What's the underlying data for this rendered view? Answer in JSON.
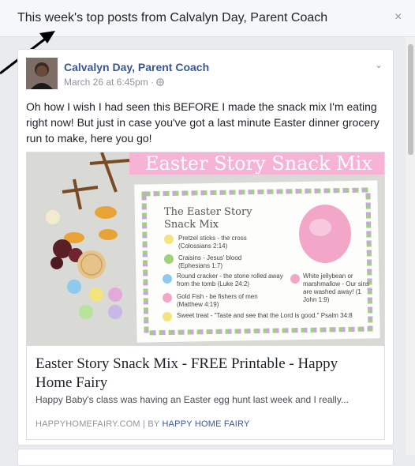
{
  "header": {
    "title": "This week's top posts from Calvalyn Day, Parent Coach",
    "close_glyph": "×"
  },
  "post": {
    "author": "Calvalyn Day, Parent Coach",
    "timestamp": "March 26 at 6:45pm",
    "meta_separator": " · ",
    "audience_icon": "globe-icon",
    "menu_glyph": "⌄",
    "text": "Oh how I wish I had seen this BEFORE I made the snack mix I'm eating right now! But just in case you've got a last minute Easter dinner grocery run to make, here you go!",
    "link": {
      "image": {
        "banner_text": "Easter Story Snack Mix",
        "card_title": "The Easter Story Snack Mix",
        "items": [
          {
            "text": "Pretzel sticks - the cross",
            "ref": "(Colossians 2:14)"
          },
          {
            "text": "Craisins - Jesus' blood",
            "ref": "(Ephesians 1:7)"
          },
          {
            "text": "Round cracker - the stone rolled away from the tomb",
            "ref": "(Luke 24:2)"
          },
          {
            "text": "Gold Fish - be fishers of men",
            "ref": "(Matthew 4:19)"
          },
          {
            "text": "Sweet treat - \"Taste and see that the Lord is good.\"",
            "ref": "Psalm 34:8"
          }
        ],
        "side_note": "White jellybean or marshmallow - Our sins are washed away! (1 John 1:9)"
      },
      "title": "Easter Story Snack Mix - FREE Printable - Happy Home Fairy",
      "description": "Happy Baby's class was having an Easter egg hunt last week and I really...",
      "domain": "HAPPYHOMEFAIRY.COM",
      "separator": " | ",
      "by_prefix": "BY ",
      "by_author": "HAPPY HOME FAIRY"
    }
  },
  "colors": {
    "link_blue": "#365899",
    "text": "#1d2129",
    "muted": "#90949c",
    "banner_pink": "#f7b3d6"
  }
}
